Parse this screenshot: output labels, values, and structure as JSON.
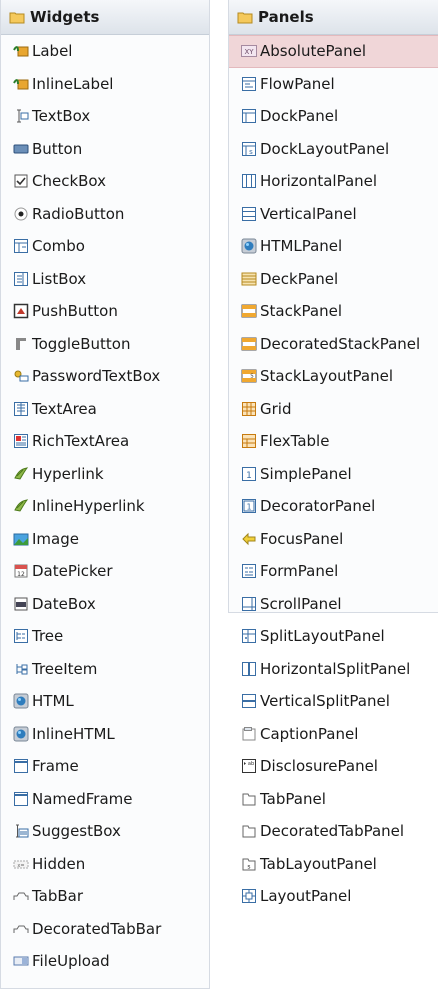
{
  "widgets": {
    "title": "Widgets",
    "items": [
      {
        "label": "Label",
        "icon": "label-icon"
      },
      {
        "label": "InlineLabel",
        "icon": "inline-label-icon"
      },
      {
        "label": "TextBox",
        "icon": "textbox-icon"
      },
      {
        "label": "Button",
        "icon": "button-icon"
      },
      {
        "label": "CheckBox",
        "icon": "checkbox-icon"
      },
      {
        "label": "RadioButton",
        "icon": "radio-button-icon"
      },
      {
        "label": "Combo",
        "icon": "combo-icon"
      },
      {
        "label": "ListBox",
        "icon": "listbox-icon"
      },
      {
        "label": "PushButton",
        "icon": "push-button-icon"
      },
      {
        "label": "ToggleButton",
        "icon": "toggle-button-icon"
      },
      {
        "label": "PasswordTextBox",
        "icon": "password-textbox-icon"
      },
      {
        "label": "TextArea",
        "icon": "textarea-icon"
      },
      {
        "label": "RichTextArea",
        "icon": "rich-textarea-icon"
      },
      {
        "label": "Hyperlink",
        "icon": "hyperlink-icon"
      },
      {
        "label": "InlineHyperlink",
        "icon": "inline-hyperlink-icon"
      },
      {
        "label": "Image",
        "icon": "image-icon"
      },
      {
        "label": "DatePicker",
        "icon": "datepicker-icon"
      },
      {
        "label": "DateBox",
        "icon": "datebox-icon"
      },
      {
        "label": "Tree",
        "icon": "tree-icon"
      },
      {
        "label": "TreeItem",
        "icon": "treeitem-icon"
      },
      {
        "label": "HTML",
        "icon": "html-icon"
      },
      {
        "label": "InlineHTML",
        "icon": "inline-html-icon"
      },
      {
        "label": "Frame",
        "icon": "frame-icon"
      },
      {
        "label": "NamedFrame",
        "icon": "named-frame-icon"
      },
      {
        "label": "SuggestBox",
        "icon": "suggestbox-icon"
      },
      {
        "label": "Hidden",
        "icon": "hidden-icon"
      },
      {
        "label": "TabBar",
        "icon": "tabbar-icon"
      },
      {
        "label": "DecoratedTabBar",
        "icon": "decorated-tabbar-icon"
      },
      {
        "label": "FileUpload",
        "icon": "fileupload-icon"
      }
    ]
  },
  "panels": {
    "title": "Panels",
    "selected_index": 0,
    "items": [
      {
        "label": "AbsolutePanel",
        "icon": "absolute-panel-icon"
      },
      {
        "label": "FlowPanel",
        "icon": "flow-panel-icon"
      },
      {
        "label": "DockPanel",
        "icon": "dock-panel-icon"
      },
      {
        "label": "DockLayoutPanel",
        "icon": "dock-layout-panel-icon"
      },
      {
        "label": "HorizontalPanel",
        "icon": "horizontal-panel-icon"
      },
      {
        "label": "VerticalPanel",
        "icon": "vertical-panel-icon"
      },
      {
        "label": "HTMLPanel",
        "icon": "html-panel-icon"
      },
      {
        "label": "DeckPanel",
        "icon": "deck-panel-icon"
      },
      {
        "label": "StackPanel",
        "icon": "stack-panel-icon"
      },
      {
        "label": "DecoratedStackPanel",
        "icon": "decorated-stack-panel-icon"
      },
      {
        "label": "StackLayoutPanel",
        "icon": "stack-layout-panel-icon"
      },
      {
        "label": "Grid",
        "icon": "grid-icon"
      },
      {
        "label": "FlexTable",
        "icon": "flextable-icon"
      },
      {
        "label": "SimplePanel",
        "icon": "simple-panel-icon"
      },
      {
        "label": "DecoratorPanel",
        "icon": "decorator-panel-icon"
      },
      {
        "label": "FocusPanel",
        "icon": "focus-panel-icon"
      },
      {
        "label": "FormPanel",
        "icon": "form-panel-icon"
      },
      {
        "label": "ScrollPanel",
        "icon": "scroll-panel-icon"
      },
      {
        "label": "SplitLayoutPanel",
        "icon": "split-layout-panel-icon"
      },
      {
        "label": "HorizontalSplitPanel",
        "icon": "horizontal-split-panel-icon"
      },
      {
        "label": "VerticalSplitPanel",
        "icon": "vertical-split-panel-icon"
      },
      {
        "label": "CaptionPanel",
        "icon": "caption-panel-icon"
      },
      {
        "label": "DisclosurePanel",
        "icon": "disclosure-panel-icon"
      },
      {
        "label": "TabPanel",
        "icon": "tab-panel-icon"
      },
      {
        "label": "DecoratedTabPanel",
        "icon": "decorated-tab-panel-icon"
      },
      {
        "label": "TabLayoutPanel",
        "icon": "tab-layout-panel-icon"
      },
      {
        "label": "LayoutPanel",
        "icon": "layout-panel-icon"
      }
    ]
  },
  "colors": {
    "selection": "#f0d6d8",
    "folder": "#f5c95c",
    "frame_blue": "#3a6ea5"
  }
}
